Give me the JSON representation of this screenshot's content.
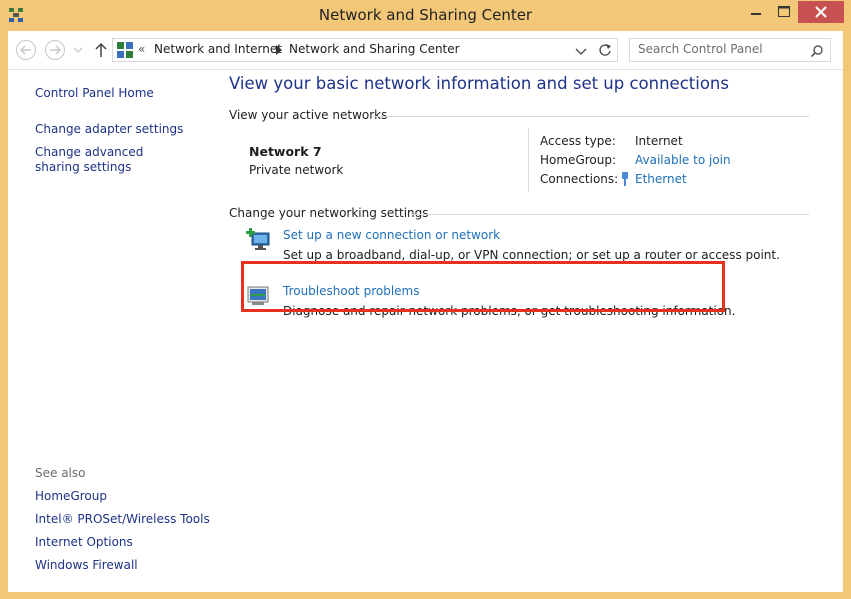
{
  "window": {
    "title": "Network and Sharing Center"
  },
  "navbar": {
    "breadcrumb_overflow": "«",
    "breadcrumb": [
      "Network and Internet",
      "Network and Sharing Center"
    ],
    "search_placeholder": "Search Control Panel"
  },
  "left_pane": {
    "links": [
      "Control Panel Home",
      "Change adapter settings",
      "Change advanced sharing settings"
    ],
    "see_also_label": "See also",
    "see_also": [
      "HomeGroup",
      "Intel® PROSet/Wireless Tools",
      "Internet Options",
      "Windows Firewall"
    ]
  },
  "main": {
    "heading": "View your basic network information and set up connections",
    "active_networks_title": "View your active networks",
    "network": {
      "name": "Network  7",
      "type": "Private network"
    },
    "properties": {
      "access_type_label": "Access type:",
      "access_type_value": "Internet",
      "homegroup_label": "HomeGroup:",
      "homegroup_value": "Available to join",
      "connections_label": "Connections:",
      "connections_value": "Ethernet"
    },
    "settings_title": "Change your networking settings",
    "tasks": [
      {
        "link": "Set up a new connection or network",
        "description": "Set up a broadband, dial-up, or VPN connection; or set up a router or access point."
      },
      {
        "link": "Troubleshoot problems",
        "description": "Diagnose and repair network problems, or get troubleshooting information."
      }
    ]
  },
  "colors": {
    "frame": "#f2c777",
    "link": "#1f6fb9",
    "nav_link": "#1e3287",
    "close_button": "#c75050",
    "highlight_border": "#e4321f"
  },
  "icons": [
    "network-center-icon",
    "minimize-icon",
    "maximize-icon",
    "close-icon",
    "back-arrow-icon",
    "forward-arrow-icon",
    "recent-pages-chevron-icon",
    "up-arrow-icon",
    "control-panel-icon",
    "breadcrumb-separator-icon",
    "dropdown-chevron-icon",
    "refresh-icon",
    "search-icon",
    "ethernet-plug-icon",
    "new-connection-icon",
    "troubleshoot-icon"
  ]
}
